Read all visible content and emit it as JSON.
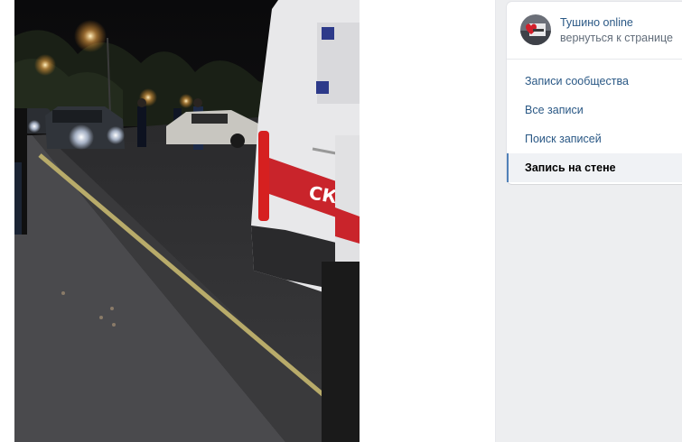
{
  "photo": {
    "alt_icon": "photo-night-street"
  },
  "group": {
    "name": "Тушино online",
    "back_link": "вернуться к странице",
    "avatar_icon": "group-avatar-icon"
  },
  "menu": {
    "items": [
      {
        "label": "Записи сообщества",
        "active": false
      },
      {
        "label": "Все записи",
        "active": false
      },
      {
        "label": "Поиск записей",
        "active": false
      },
      {
        "label": "Запись на стене",
        "active": true
      }
    ]
  },
  "colors": {
    "link": "#2a5885",
    "muted": "#626d7a",
    "accent": "#5181b8",
    "panel_bg": "#edeef0"
  }
}
